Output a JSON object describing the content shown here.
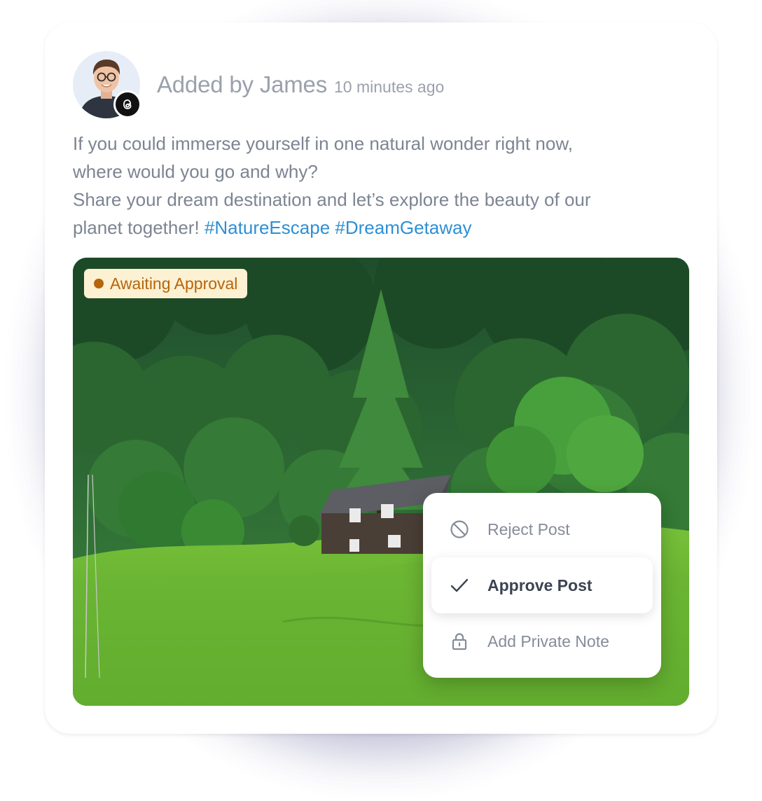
{
  "post": {
    "author": "Added by James",
    "time": "10 minutes ago",
    "platform_icon": "threads-icon",
    "lines": [
      "If you could immerse yourself in one natural wonder right now,",
      "where would you go and why?",
      "Share your dream destination and let’s explore the beauty of our",
      "planet together!"
    ],
    "hashtags": [
      "#NatureEscape",
      "#DreamGetaway"
    ]
  },
  "status_badge": {
    "label": "Awaiting Approval",
    "color": "#b6650b",
    "background": "#fdf1d3"
  },
  "menu": {
    "items": [
      {
        "label": "Reject Post",
        "icon": "block-icon"
      },
      {
        "label": "Approve Post",
        "icon": "check-icon",
        "active": true
      },
      {
        "label": "Add Private Note",
        "icon": "lock-icon"
      }
    ]
  },
  "colors": {
    "hashtag": "#2d8fd5",
    "text": "#7d8492",
    "muted": "#9aa1ad"
  }
}
